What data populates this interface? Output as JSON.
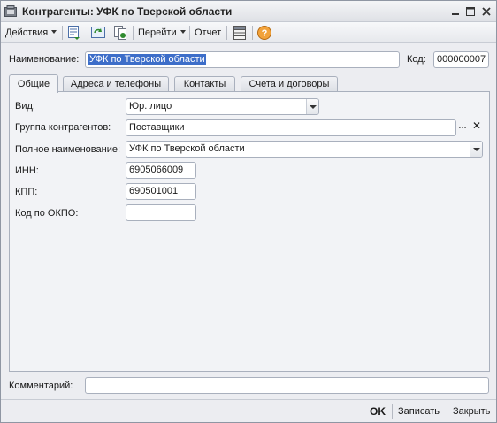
{
  "window": {
    "title": "Контрагенты: УФК по Тверской области"
  },
  "toolbar": {
    "actions_label": "Действия",
    "goto_label": "Перейти",
    "report_label": "Отчет"
  },
  "header": {
    "name_label": "Наименование:",
    "name_value": "УФК по Тверской области",
    "code_label": "Код:",
    "code_value": "000000007"
  },
  "tabs": [
    {
      "label": "Общие",
      "active": true
    },
    {
      "label": "Адреса и телефоны",
      "active": false
    },
    {
      "label": "Контакты",
      "active": false
    },
    {
      "label": "Счета и договоры",
      "active": false
    }
  ],
  "general": {
    "kind_label": "Вид:",
    "kind_value": "Юр. лицо",
    "group_label": "Группа контрагентов:",
    "group_value": "Поставщики",
    "group_choose": "...",
    "group_clear": "✕",
    "full_name_label": "Полное наименование:",
    "full_name_value": "УФК по Тверской области",
    "inn_label": "ИНН:",
    "inn_value": "6905066009",
    "kpp_label": "КПП:",
    "kpp_value": "690501001",
    "okpo_label": "Код по ОКПО:",
    "okpo_value": ""
  },
  "comment": {
    "label": "Комментарий:",
    "value": ""
  },
  "buttons": {
    "ok": "OK",
    "save": "Записать",
    "close": "Закрыть"
  }
}
